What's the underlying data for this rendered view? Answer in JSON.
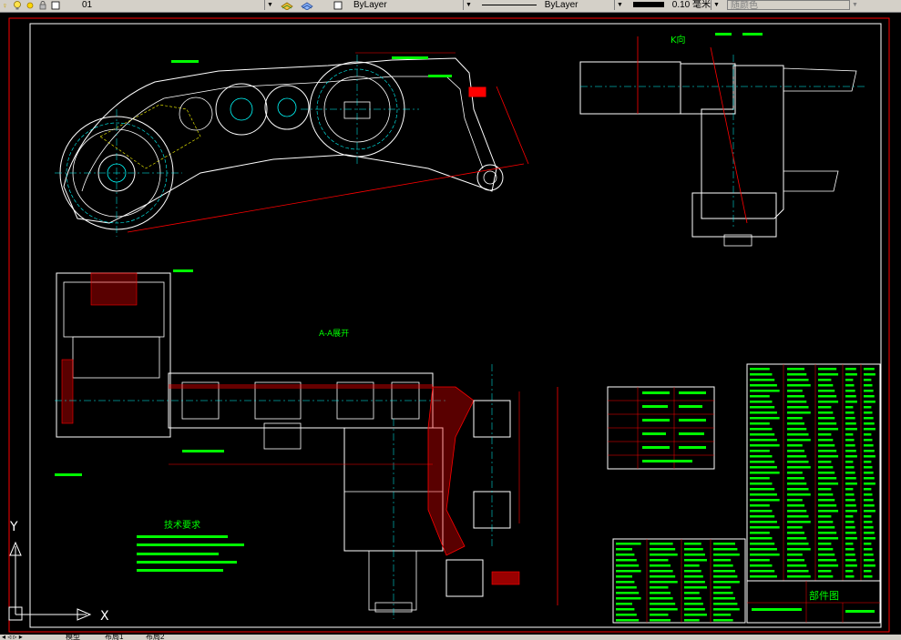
{
  "toolbar": {
    "layer_value": "01",
    "color_value": "ByLayer",
    "linetype_value": "ByLayer",
    "lineweight_value": "0.10 毫米",
    "plotstyle_value": "随颜色"
  },
  "drawing": {
    "view_k_label": "K向",
    "section_label": "A-A展开",
    "tech_req_title": "技术要求",
    "title_block_name": "部件图"
  },
  "ucs": {
    "x_label": "X",
    "y_label": "Y"
  },
  "tabs": [
    "模型",
    "布局1",
    "布局2"
  ],
  "colors": {
    "background": "#000000",
    "geometry": "#ffffff",
    "dims": "#00ffff",
    "text": "#00ff00",
    "section": "#ff0000",
    "border": "#ff0000"
  }
}
